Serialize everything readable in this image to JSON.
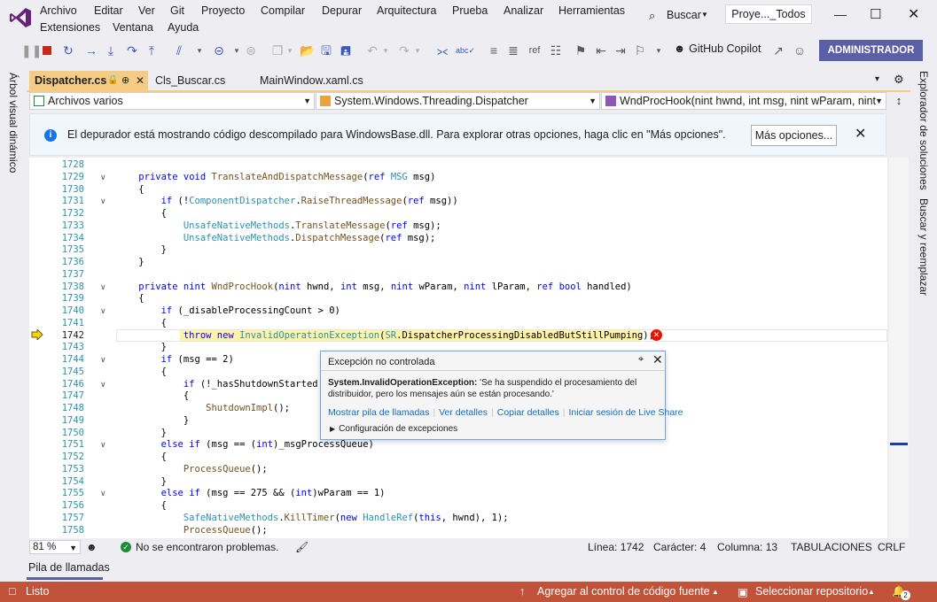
{
  "menu": {
    "items": [
      "Archivo",
      "Editar",
      "Ver",
      "Git",
      "Proyecto",
      "Compilar",
      "Depurar",
      "Arquitectura",
      "Prueba",
      "Analizar",
      "Herramientas",
      "Extensiones",
      "Ventana",
      "Ayuda"
    ],
    "search_label": "Buscar",
    "solution_name": "Proye..._Todos"
  },
  "toolbar": {
    "copilot_label": "GitHub Copilot",
    "admin_label": "ADMINISTRADOR"
  },
  "side_panels": {
    "left": "Árbol visual dinámico",
    "right_top": "Explorador de soluciones",
    "right_bottom": "Buscar y reemplazar"
  },
  "tabs": [
    {
      "label": "Dispatcher.cs",
      "active": true
    },
    {
      "label": "Cls_Buscar.cs",
      "active": false
    },
    {
      "label": "MainWindow.xaml.cs",
      "active": false
    }
  ],
  "navbar": {
    "project": "Archivos varios",
    "type": "System.Windows.Threading.Dispatcher",
    "member": "WndProcHook(nint hwnd, int msg, nint wParam, nint"
  },
  "infobar": {
    "message": "El depurador está mostrando código descompilado para WindowsBase.dll. Para explorar otras opciones, haga clic en \"Más opciones\".",
    "button": "Más opciones..."
  },
  "editor": {
    "current_line": 1742,
    "lines": [
      {
        "n": "1728",
        "t": ""
      },
      {
        "n": "1729",
        "t": "    private void TranslateAndDispatchMessage(ref MSG msg)"
      },
      {
        "n": "1730",
        "t": "    {"
      },
      {
        "n": "1731",
        "t": "        if (!ComponentDispatcher.RaiseThreadMessage(ref msg))"
      },
      {
        "n": "1732",
        "t": "        {"
      },
      {
        "n": "1733",
        "t": "            UnsafeNativeMethods.TranslateMessage(ref msg);"
      },
      {
        "n": "1734",
        "t": "            UnsafeNativeMethods.DispatchMessage(ref msg);"
      },
      {
        "n": "1735",
        "t": "        }"
      },
      {
        "n": "1736",
        "t": "    }"
      },
      {
        "n": "1737",
        "t": ""
      },
      {
        "n": "1738",
        "t": "    private nint WndProcHook(nint hwnd, int msg, nint wParam, nint lParam, ref bool handled)"
      },
      {
        "n": "1739",
        "t": "    {"
      },
      {
        "n": "1740",
        "t": "        if (_disableProcessingCount > 0)"
      },
      {
        "n": "1741",
        "t": "        {"
      },
      {
        "n": "1742",
        "t": "            throw new InvalidOperationException(SR.DispatcherProcessingDisabledButStillPumping);"
      },
      {
        "n": "1743",
        "t": "        }"
      },
      {
        "n": "1744",
        "t": "        if (msg == 2)"
      },
      {
        "n": "1745",
        "t": "        {"
      },
      {
        "n": "1746",
        "t": "            if (!_hasShutdownStarted &"
      },
      {
        "n": "1747",
        "t": "            {"
      },
      {
        "n": "1748",
        "t": "                ShutdownImpl();"
      },
      {
        "n": "1749",
        "t": "            }"
      },
      {
        "n": "1750",
        "t": "        }"
      },
      {
        "n": "1751",
        "t": "        else if (msg == (int)_msgProcessQueue)"
      },
      {
        "n": "1752",
        "t": "        {"
      },
      {
        "n": "1753",
        "t": "            ProcessQueue();"
      },
      {
        "n": "1754",
        "t": "        }"
      },
      {
        "n": "1755",
        "t": "        else if (msg == 275 && (int)wParam == 1)"
      },
      {
        "n": "1756",
        "t": "        {"
      },
      {
        "n": "1757",
        "t": "            SafeNativeMethods.KillTimer(new HandleRef(this, hwnd), 1);"
      },
      {
        "n": "1758",
        "t": "            ProcessQueue();"
      }
    ]
  },
  "exception": {
    "title": "Excepción no controlada",
    "type": "System.InvalidOperationException:",
    "message": " 'Se ha suspendido el procesamiento del distribuidor, pero los mensajes aún se están procesando.'",
    "links": [
      "Mostrar pila de llamadas",
      "Ver detalles",
      "Copiar detalles",
      "Iniciar sesión de Live Share"
    ],
    "config": "Configuración de excepciones"
  },
  "editor_status": {
    "zoom": "81 %",
    "problems": "No se encontraron problemas.",
    "line": "Línea: 1742",
    "char": "Carácter: 4",
    "column": "Columna: 13",
    "tabs": "TABULACIONES",
    "eol": "CRLF"
  },
  "bottom_panel": {
    "tab": "Pila de llamadas"
  },
  "statusbar": {
    "state": "Listo",
    "source_control": "Agregar al control de código fuente",
    "repo": "Seleccionar repositorio",
    "notifications": "2"
  },
  "colors": {
    "accent": "#5b5fa6",
    "status_bar": "#c0533a",
    "active_tab": "#f5cc84",
    "error": "#e51400"
  }
}
